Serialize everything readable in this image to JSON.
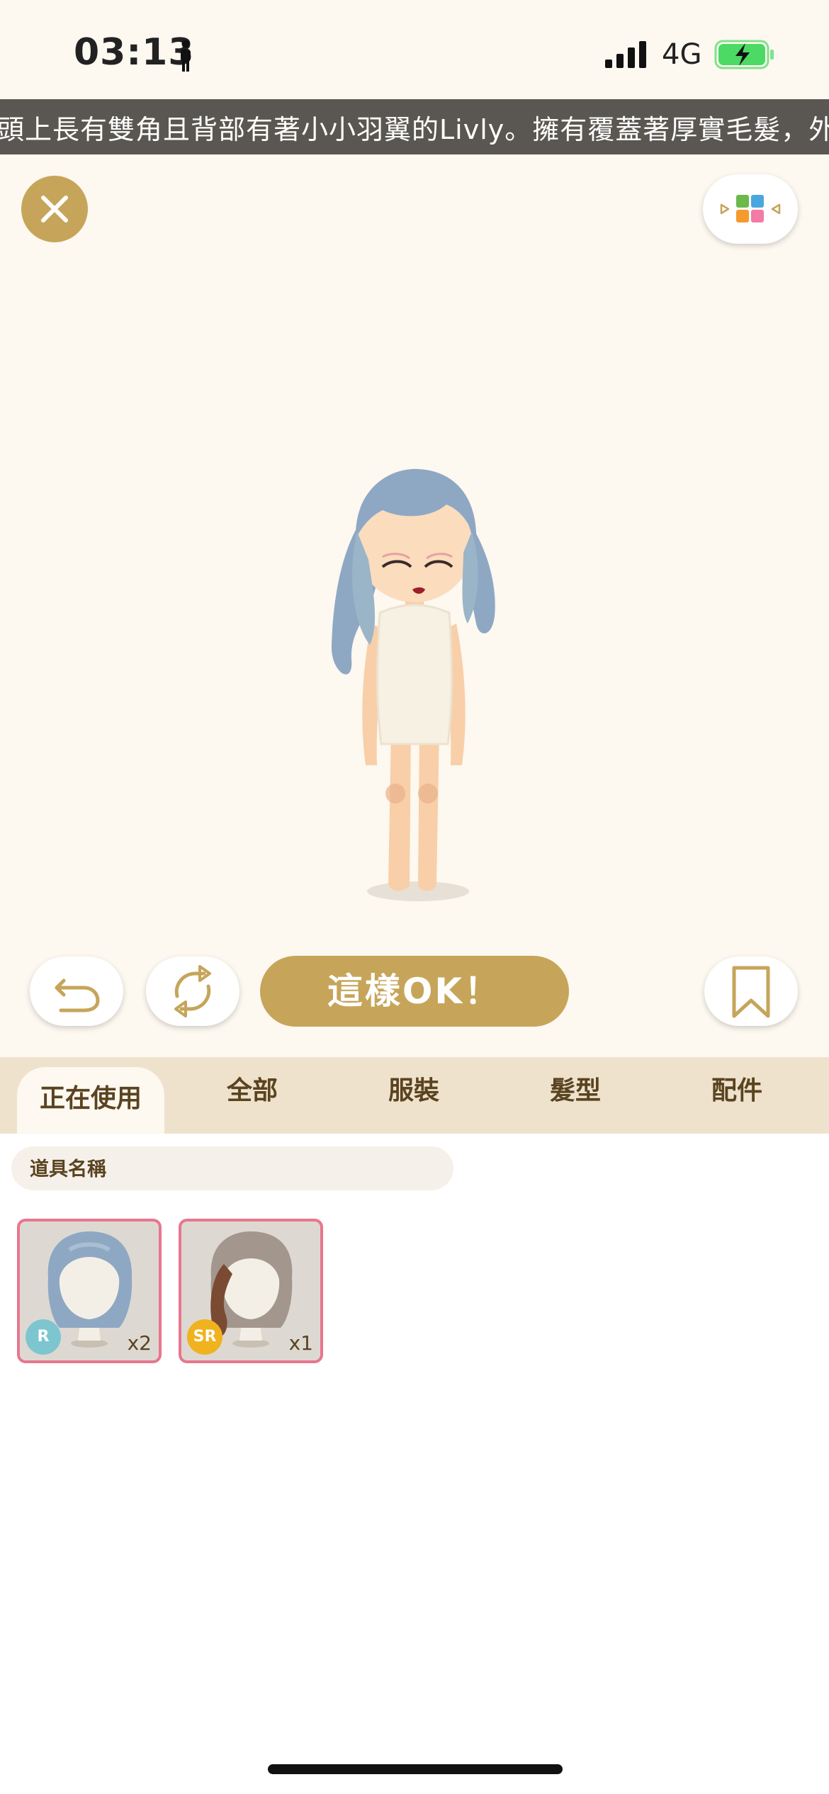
{
  "status_bar": {
    "time": "03:13",
    "network": "4G"
  },
  "description_marquee": "頭上長有雙角且背部有著小小羽翼的Livly。擁有覆蓋著厚實毛髮，外型突",
  "actions": {
    "ok_label": "這樣OK！"
  },
  "tabs": [
    {
      "label": "正在使用",
      "active": true
    },
    {
      "label": "全部",
      "active": false
    },
    {
      "label": "服裝",
      "active": false
    },
    {
      "label": "髮型",
      "active": false
    },
    {
      "label": "配件",
      "active": false
    }
  ],
  "search": {
    "placeholder": "道具名稱"
  },
  "items": [
    {
      "rarity": "R",
      "quantity": "x2",
      "rarity_color": "#7ec6cf"
    },
    {
      "rarity": "SR",
      "quantity": "x1",
      "rarity_color": "#f0b21e"
    }
  ],
  "colors": {
    "accent_gold": "#c6a55a",
    "item_border_pink": "#e8768e",
    "tab_bar": "#eee2cc",
    "battery_green": "#4cd964"
  }
}
